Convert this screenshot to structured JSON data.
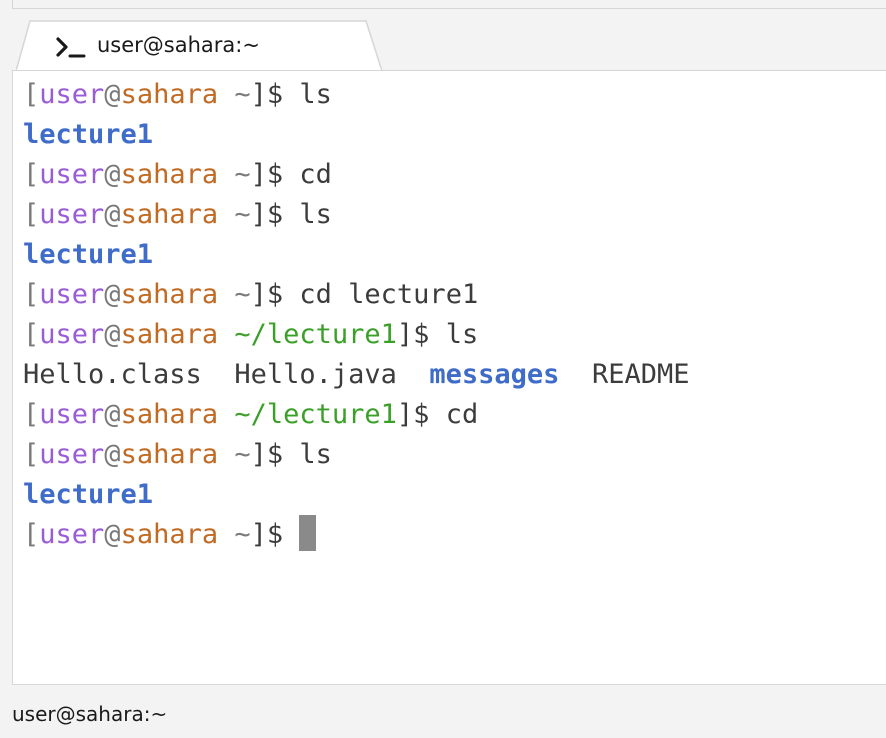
{
  "tab": {
    "icon": "terminal-prompt-icon",
    "title": "user@sahara:~"
  },
  "terminal": {
    "lines": [
      [
        {
          "t": "[",
          "c": "dim"
        },
        {
          "t": "user",
          "c": "user"
        },
        {
          "t": "@",
          "c": "dim"
        },
        {
          "t": "sahara",
          "c": "host"
        },
        {
          "t": " ~",
          "c": "dim"
        },
        {
          "t": "]$ ls",
          "c": "plain"
        }
      ],
      [
        {
          "t": "lecture1",
          "c": "dir"
        }
      ],
      [
        {
          "t": "[",
          "c": "dim"
        },
        {
          "t": "user",
          "c": "user"
        },
        {
          "t": "@",
          "c": "dim"
        },
        {
          "t": "sahara",
          "c": "host"
        },
        {
          "t": " ~",
          "c": "dim"
        },
        {
          "t": "]$ cd",
          "c": "plain"
        }
      ],
      [
        {
          "t": "[",
          "c": "dim"
        },
        {
          "t": "user",
          "c": "user"
        },
        {
          "t": "@",
          "c": "dim"
        },
        {
          "t": "sahara",
          "c": "host"
        },
        {
          "t": " ~",
          "c": "dim"
        },
        {
          "t": "]$ ls",
          "c": "plain"
        }
      ],
      [
        {
          "t": "lecture1",
          "c": "dir"
        }
      ],
      [
        {
          "t": "[",
          "c": "dim"
        },
        {
          "t": "user",
          "c": "user"
        },
        {
          "t": "@",
          "c": "dim"
        },
        {
          "t": "sahara",
          "c": "host"
        },
        {
          "t": " ~",
          "c": "dim"
        },
        {
          "t": "]$ cd lecture1",
          "c": "plain"
        }
      ],
      [
        {
          "t": "[",
          "c": "dim"
        },
        {
          "t": "user",
          "c": "user"
        },
        {
          "t": "@",
          "c": "dim"
        },
        {
          "t": "sahara",
          "c": "host"
        },
        {
          "t": " ~/lecture1",
          "c": "path"
        },
        {
          "t": "]$ ls",
          "c": "plain"
        }
      ],
      [
        {
          "t": "Hello.class  Hello.java  ",
          "c": "plain"
        },
        {
          "t": "messages",
          "c": "dir"
        },
        {
          "t": "  README",
          "c": "plain"
        }
      ],
      [
        {
          "t": "[",
          "c": "dim"
        },
        {
          "t": "user",
          "c": "user"
        },
        {
          "t": "@",
          "c": "dim"
        },
        {
          "t": "sahara",
          "c": "host"
        },
        {
          "t": " ~/lecture1",
          "c": "path"
        },
        {
          "t": "]$ cd",
          "c": "plain"
        }
      ],
      [
        {
          "t": "[",
          "c": "dim"
        },
        {
          "t": "user",
          "c": "user"
        },
        {
          "t": "@",
          "c": "dim"
        },
        {
          "t": "sahara",
          "c": "host"
        },
        {
          "t": " ~",
          "c": "dim"
        },
        {
          "t": "]$ ls",
          "c": "plain"
        }
      ],
      [
        {
          "t": "lecture1",
          "c": "dir"
        }
      ],
      [
        {
          "t": "[",
          "c": "dim"
        },
        {
          "t": "user",
          "c": "user"
        },
        {
          "t": "@",
          "c": "dim"
        },
        {
          "t": "sahara",
          "c": "host"
        },
        {
          "t": " ~",
          "c": "dim"
        },
        {
          "t": "]$ ",
          "c": "plain"
        },
        {
          "t": "",
          "c": "cursor"
        }
      ]
    ],
    "colors": {
      "user": "#9a5cd6",
      "host": "#c06a24",
      "path": "#3aa028",
      "directory": "#3f6cc9",
      "text": "#3c3c3c",
      "cursor": "#8a8a8a"
    }
  },
  "status_bar": {
    "title": "user@sahara:~"
  }
}
